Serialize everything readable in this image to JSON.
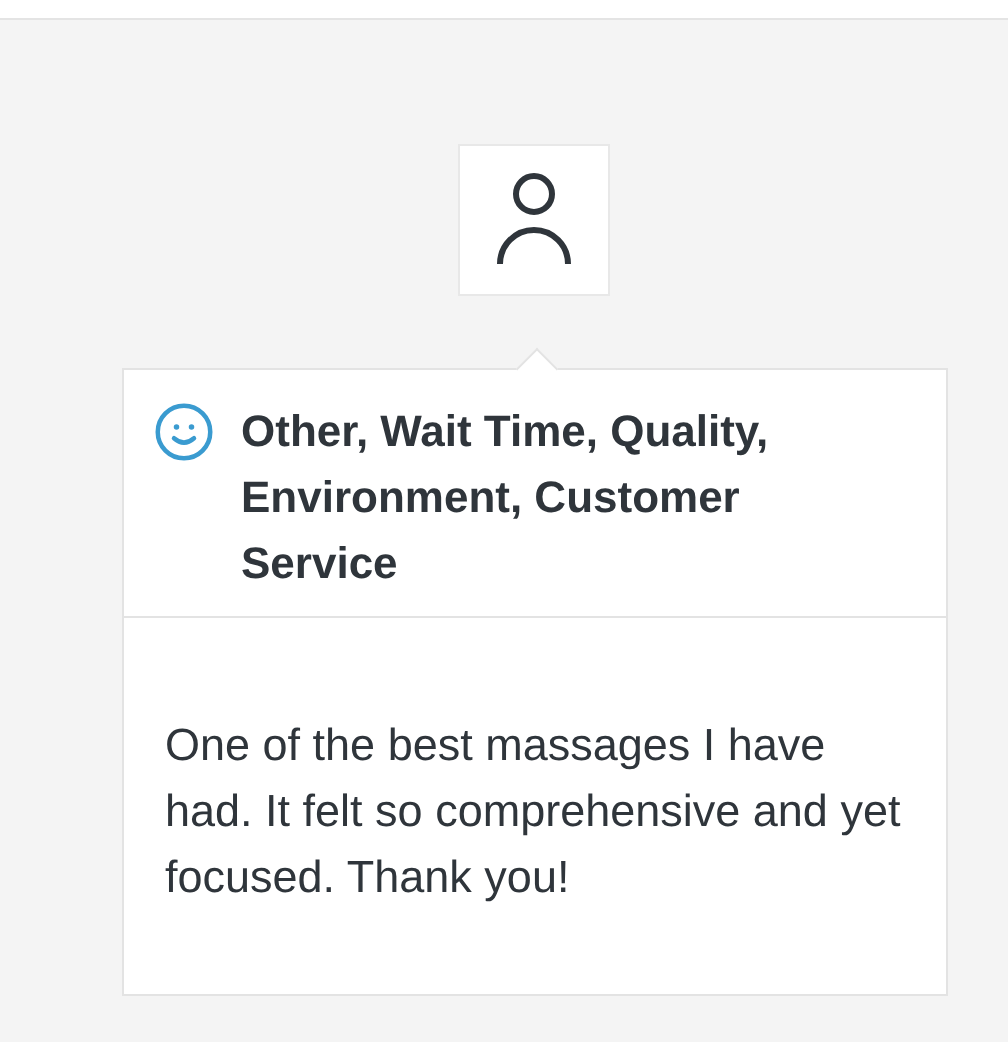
{
  "review": {
    "categories": "Other, Wait Time, Quality, Environment, Customer Service",
    "comment": "One of the best massages I have had. It felt so comprehensive and yet focused. Thank you!"
  }
}
